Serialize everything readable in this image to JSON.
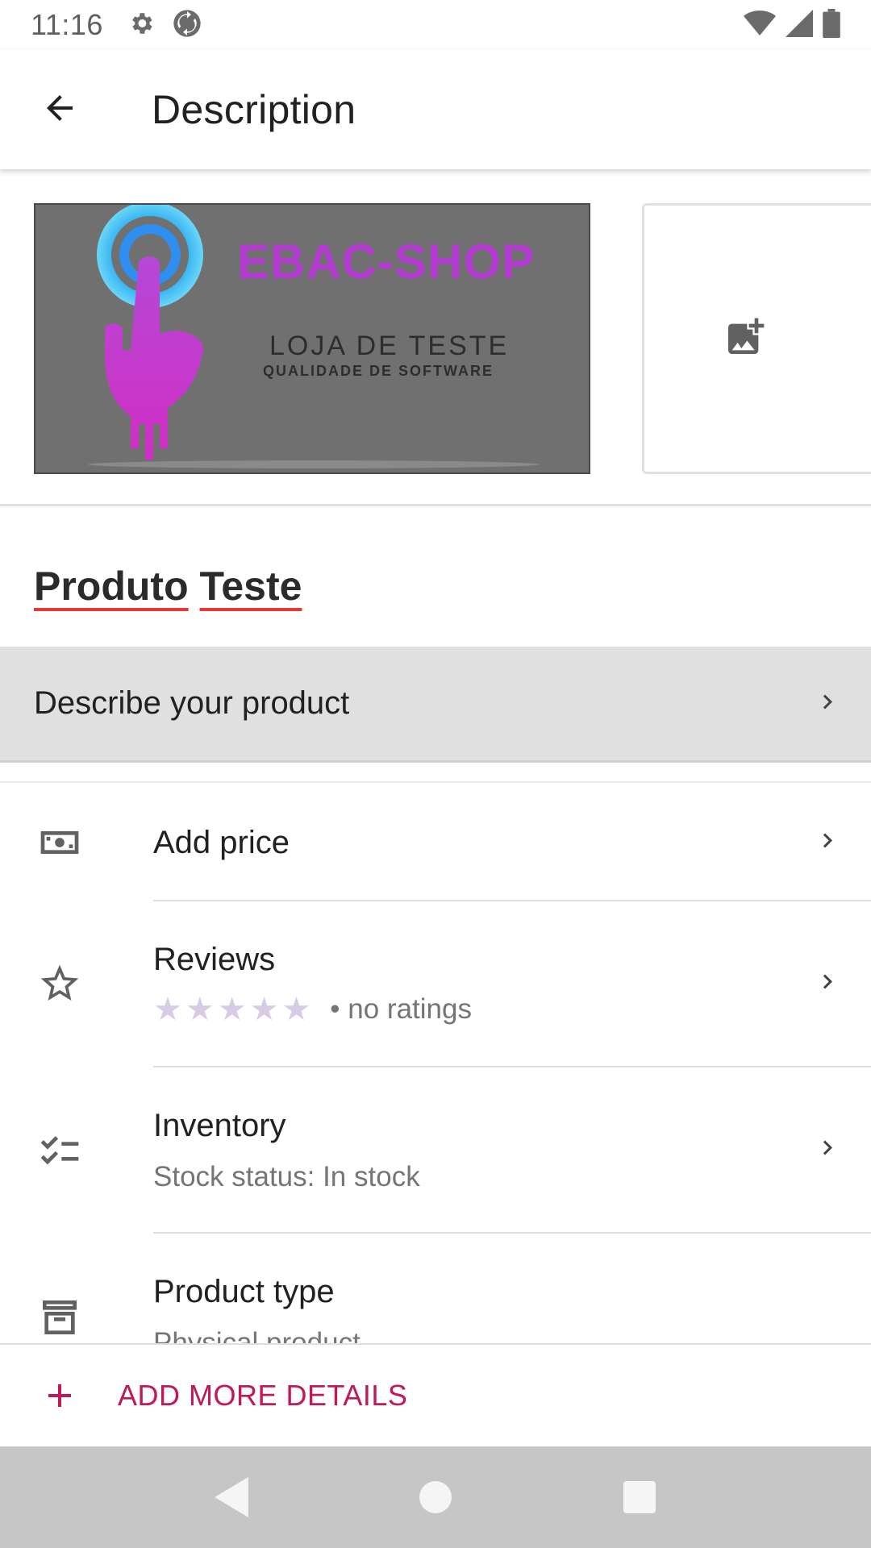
{
  "status_bar": {
    "time": "11:16",
    "icons": [
      "settings-icon",
      "sync-icon",
      "wifi-icon",
      "signal-icon",
      "battery-icon"
    ]
  },
  "app_bar": {
    "title": "Description",
    "back_icon": "arrow-back-icon"
  },
  "images": {
    "product_logo": {
      "brand": "EBAC-SHOP",
      "line1": "LOJA DE TESTE",
      "line2": "QUALIDADE DE SOFTWARE"
    },
    "add_image_icon": "add-photo-icon"
  },
  "product": {
    "name_word1": "Produto",
    "name_word2": "Teste"
  },
  "describe": {
    "label": "Describe your product"
  },
  "list": {
    "price": {
      "title": "Add price",
      "icon": "money-icon"
    },
    "reviews": {
      "title": "Reviews",
      "rating_text": "• no ratings",
      "stars": 0,
      "max_stars": 5,
      "icon": "star-outline-icon"
    },
    "inventory": {
      "title": "Inventory",
      "subtitle": "Stock status: In stock",
      "icon": "checklist-icon"
    },
    "product_type": {
      "title": "Product type",
      "subtitle": "Physical product",
      "icon": "archive-icon"
    }
  },
  "add_more": {
    "label": "ADD MORE DETAILS",
    "icon": "plus-icon"
  },
  "colors": {
    "accent": "#c2185b",
    "star_empty": "#d7cbe6",
    "selected_row": "#e0e0e0"
  }
}
